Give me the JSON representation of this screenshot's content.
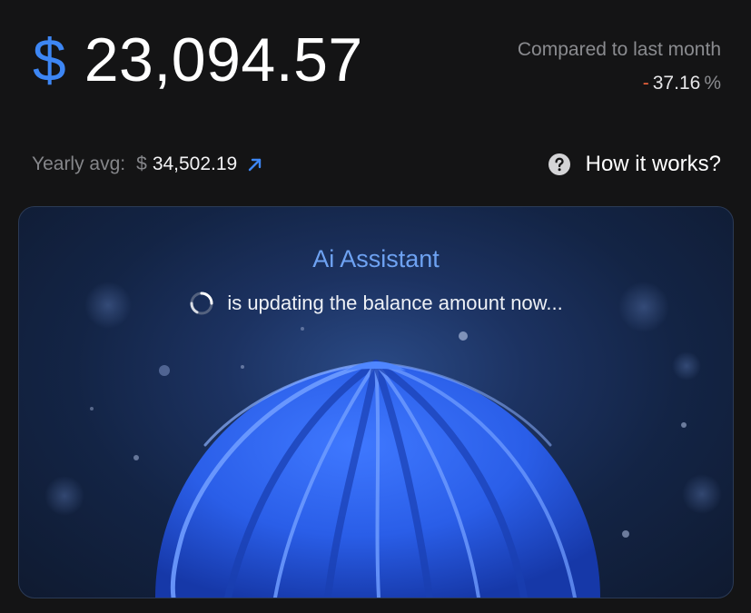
{
  "balance": {
    "currency_symbol": "$",
    "amount": "23,094.57"
  },
  "comparison": {
    "label": "Compared to last month",
    "sign": "-",
    "value": "37.16",
    "unit": "%",
    "negative_color": "#f0643c"
  },
  "yearly": {
    "label": "Yearly avg:",
    "currency_symbol": "$",
    "value": "34,502.19",
    "trend_icon": "arrow-up-right-icon"
  },
  "help": {
    "icon": "question-circle-icon",
    "label": "How it works?"
  },
  "assistant_card": {
    "title": "Ai Assistant",
    "status": "is updating the balance amount now...",
    "spinner_icon": "loading-spinner-icon",
    "accent_color": "#3d86f4"
  }
}
